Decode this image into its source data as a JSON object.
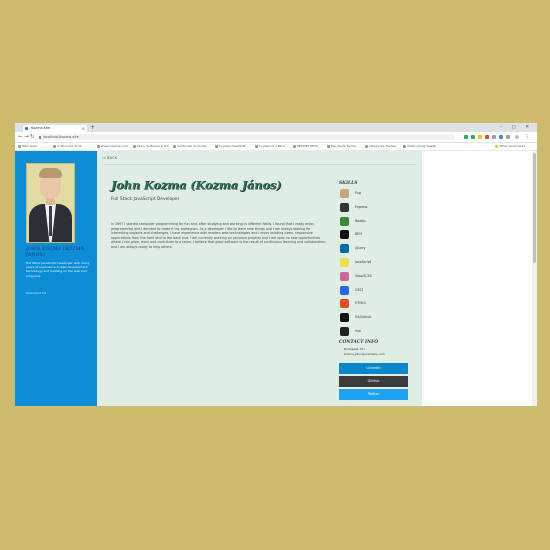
{
  "browser": {
    "tab_title": "Kozma.site",
    "new_tab": "+",
    "window_controls": "–  ▢  ✕",
    "url": "localhost/kozma.site",
    "bookmarks": [
      "Web Apps",
      "Craftscode Scrip",
      "www.meetup.com",
      "Muro: Software & Pro",
      "Kurlfondal Accounts",
      "Crystal ChessSoft",
      "Crylisbook | Baca",
      "PROMETHEUS",
      "Dev Tools Trendy",
      "Cities Jobs Tracker",
      "Oskar Doing Sweet"
    ],
    "other_bookmarks": "Other bookmarks"
  },
  "sidebar": {
    "name": "JOHN KOZMA (KOZMA JÁNOS)",
    "bio": "Full Stack JavaScript Developer with many years of experience in web development, technology and building on the web and programs.",
    "link": "Download CV"
  },
  "main": {
    "back_label": "< BACK",
    "title": "John Kozma (Kozma János)",
    "subtitle": "Full Stack JavaScript Developer",
    "paragraph": "In 1997 I started computer programming for fun and, after studying and working in different fields, I found that I really enjoy programming and I decided to make it my profession. As a developer I like to learn new things and I am always looking for interesting projects and challenges. I have experience with modern web technologies and I enjoy building clean, responsive applications from the front end to the back end. I am currently working on personal projects and I am open to new opportunities where I can grow, learn and contribute to a team. I believe that good software is the result of continuous learning and collaboration, and I am always ready to help others."
  },
  "skills": {
    "heading": "SKILLS",
    "items": [
      {
        "label": "Pug",
        "icon": "pug-icon",
        "color": "#c9a27e"
      },
      {
        "label": "Express",
        "icon": "express-icon",
        "color": "#333333"
      },
      {
        "label": "Nodejs",
        "icon": "nodejs-icon",
        "color": "#3c873a"
      },
      {
        "label": "BEM",
        "icon": "bem-icon",
        "color": "#111111"
      },
      {
        "label": "jQuery",
        "icon": "jquery-icon",
        "color": "#0769ad"
      },
      {
        "label": "JavaScript",
        "icon": "javascript-icon",
        "color": "#f0db4f"
      },
      {
        "label": "Sass/SCSS",
        "icon": "sass-icon",
        "color": "#cd6799"
      },
      {
        "label": "CSS3",
        "icon": "css3-icon",
        "color": "#2965f1"
      },
      {
        "label": "HTML5",
        "icon": "html5-icon",
        "color": "#e34f26"
      },
      {
        "label": "Git/Github",
        "icon": "git-icon",
        "color": "#111111"
      },
      {
        "label": "Vue",
        "icon": "vue-icon",
        "color": "#222222"
      }
    ]
  },
  "contact": {
    "heading": "CONTACT INFO",
    "lines": [
      "Budapest, HU",
      "kozma.john@example.com"
    ],
    "buttons": [
      {
        "label": "LinkedIn",
        "color": "#0a86c9"
      },
      {
        "label": "GitHub",
        "color": "#3b3b3b"
      },
      {
        "label": "Twitter",
        "color": "#1da1f2"
      }
    ]
  }
}
